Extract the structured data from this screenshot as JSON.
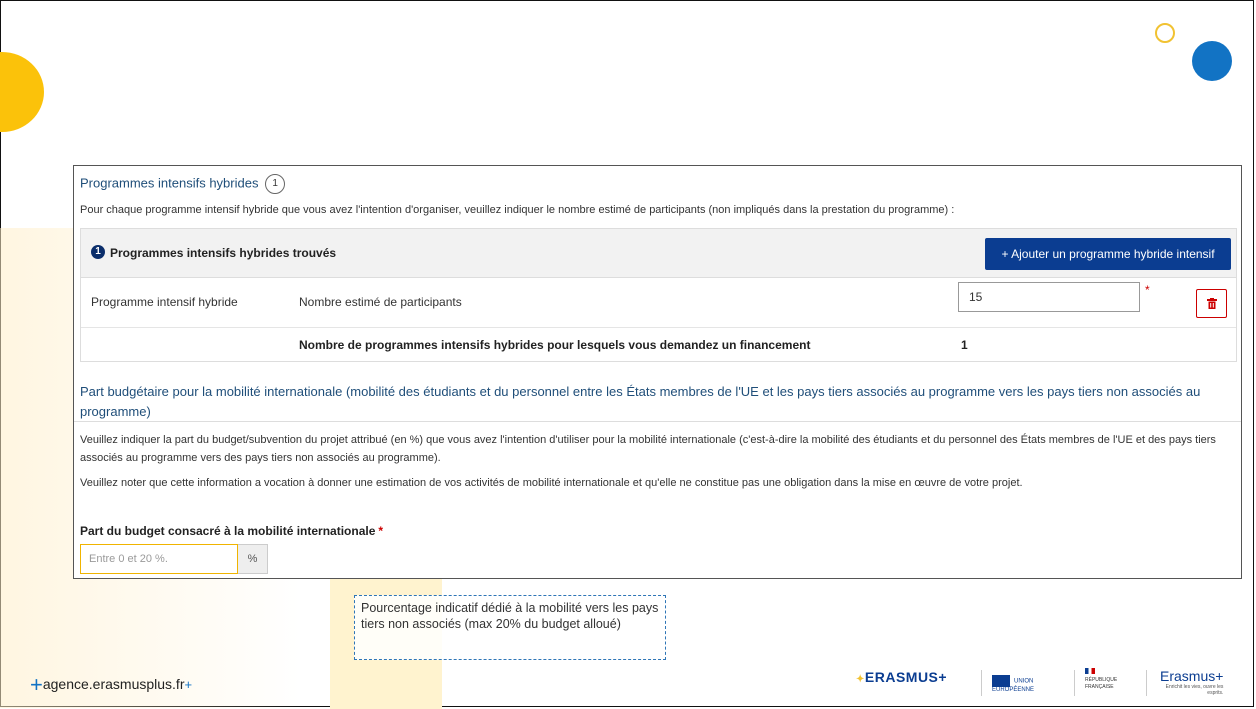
{
  "section1": {
    "title": "Programmes intensifs hybrides",
    "info_badge": "1",
    "intro": "Pour chaque programme intensif hybride que vous avez l'intention d'organiser, veuillez indiquer le nombre estimé de participants (non impliqués dans la prestation du programme) :"
  },
  "found": {
    "count": "1",
    "label": "Programmes intensifs hybrides trouvés",
    "add_button": "+  Ajouter un programme hybride intensif"
  },
  "row": {
    "col1": "Programme intensif hybride",
    "col2": "Nombre estimé de participants",
    "value": "15",
    "required_mark": "*"
  },
  "total": {
    "label": "Nombre de programmes intensifs hybrides pour lesquels vous demandez un financement",
    "value": "1"
  },
  "section2": {
    "title": "Part budgétaire pour la mobilité internationale (mobilité des étudiants et du personnel entre les États membres de l'UE et les pays tiers associés au programme vers les pays tiers non associés au programme)",
    "p1": "Veuillez indiquer la part du budget/subvention du projet attribué (en %) que vous avez l'intention d'utiliser pour la mobilité internationale (c'est-à-dire la mobilité des étudiants et du personnel des États membres de l'UE et des pays tiers associés au programme vers des pays tiers non associés au programme).",
    "p2": "Veuillez noter que cette information a vocation à donner une estimation de vos activités de mobilité internationale et qu'elle ne constitue pas une obligation dans la mise en œuvre de votre projet.",
    "budget_label": "Part du budget consacré à la mobilité internationale",
    "required_mark": "*",
    "budget_placeholder": "Entre 0 et 20 %.",
    "percent_unit": "%"
  },
  "callout": "Pourcentage indicatif dédié à la mobilité vers les pays tiers non associés (max 20% du budget alloué)",
  "footer": {
    "url": "agence.erasmusplus.fr",
    "logo_erasmus": "ERASMUS+",
    "logo_eu": "UNION EUROPÉENNE",
    "logo_rf": "RÉPUBLIQUE FRANÇAISE",
    "logo_erp": "Erasmus+",
    "logo_erp_tagline": "Enrichit les vies, ouvre les esprits."
  },
  "colors": {
    "primary_button": "#0b3d91",
    "accent_yellow": "#fbc20a",
    "accent_blue": "#1273c4",
    "required": "#cc0000"
  }
}
